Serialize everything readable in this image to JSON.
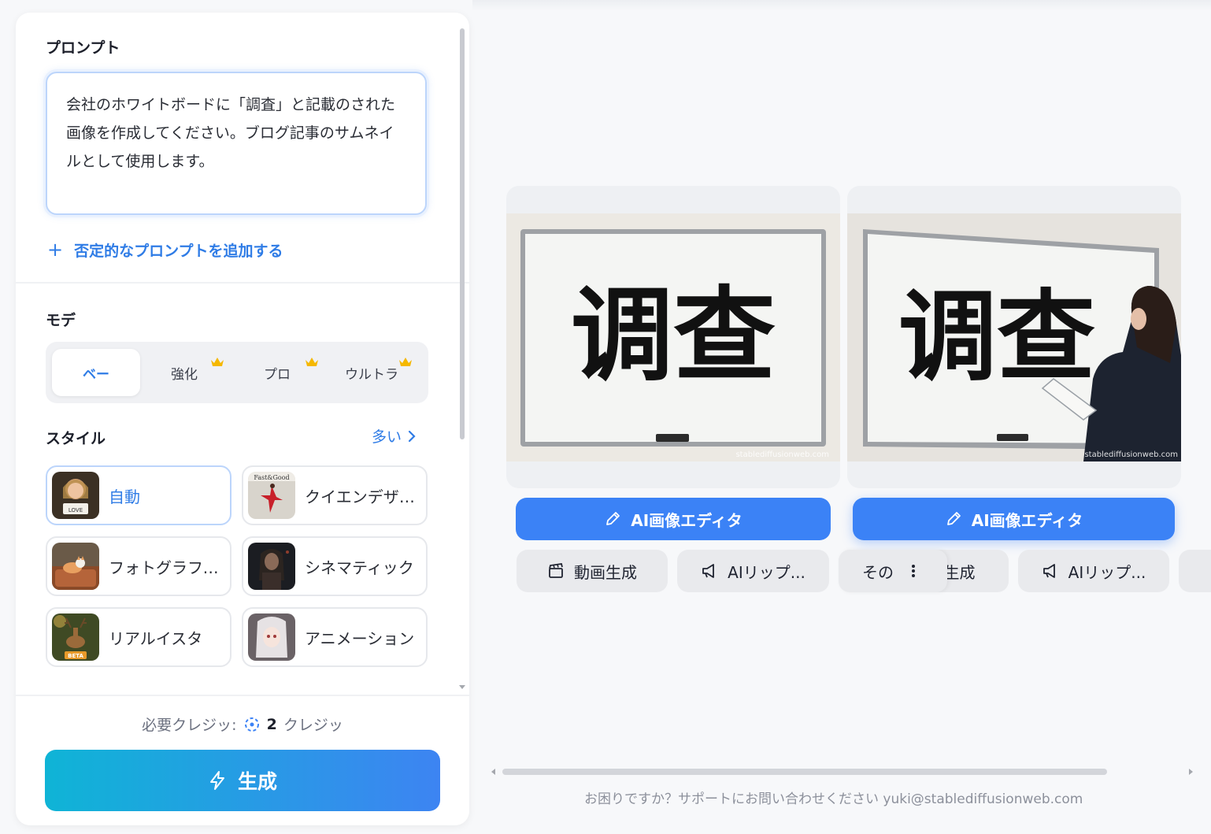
{
  "prompt": {
    "title": "プロンプト",
    "text": "会社のホワイトボードに「調査」と記載のされた画像を作成してください。ブログ記事のサムネイルとして使用します。",
    "negative_link": "否定的なプロンプトを追加する"
  },
  "mode": {
    "title": "モデ",
    "options": [
      {
        "label": "ベー",
        "selected": true,
        "premium": false
      },
      {
        "label": "強化",
        "selected": false,
        "premium": true
      },
      {
        "label": "プロ",
        "selected": false,
        "premium": true
      },
      {
        "label": "ウルトラ",
        "selected": false,
        "premium": true
      }
    ]
  },
  "style": {
    "title": "スタイル",
    "more_label": "多い",
    "items": [
      {
        "label": "自動",
        "selected": true
      },
      {
        "label": "クイエンデザイン"
      },
      {
        "label": "フォトグラフィー"
      },
      {
        "label": "シネマティック"
      },
      {
        "label": "リアルイスタ"
      },
      {
        "label": "アニメーション"
      }
    ]
  },
  "credits": {
    "label": "必要クレジッ:",
    "amount": "2",
    "unit": "クレジッ"
  },
  "generate_label": "生成",
  "results": [
    {
      "board_text": "调查",
      "watermark": "stablediffusionweb.com",
      "editor_label": "AI画像エディタ",
      "video_label": "動画生成",
      "lipsync_label": "AIリップ..."
    },
    {
      "board_text": "调查",
      "watermark": "stablediffusionweb.com",
      "editor_label": "AI画像エディタ",
      "video_label": "生成",
      "lipsync_label": "AIリップ...",
      "more_label": "その"
    }
  ],
  "support_text": "お困りですか？サポートにお問い合わせください yuki@stablediffusionweb.com",
  "colors": {
    "accent": "#3b82f6",
    "link": "#2f7ce6",
    "gradient_start": "#0fb4d6",
    "gradient_end": "#3d84f2",
    "crown": "#f5b800"
  }
}
